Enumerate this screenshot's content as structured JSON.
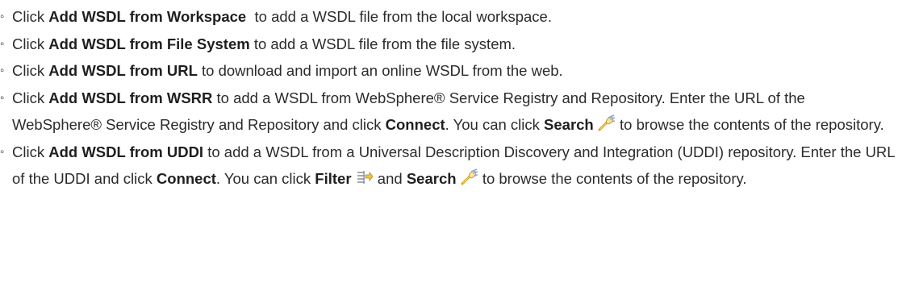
{
  "bullet_marker": "◦",
  "items": [
    {
      "pre": "Click ",
      "action": "Add WSDL from Workspace",
      "post": "  to add a WSDL file from the local workspace."
    },
    {
      "pre": "Click ",
      "action": "Add WSDL from File System",
      "post": " to add a WSDL file from the file system."
    },
    {
      "pre": "Click ",
      "action": "Add WSDL from URL",
      "post": " to download and import an online WSDL from the web."
    },
    {
      "pre": "Click ",
      "action": "Add WSDL from WSRR",
      "post1": " to add a WSDL from WebSphere® Service Registry and Repository. Enter the URL of the WebSphere® Service Registry and Repository and click ",
      "connect": "Connect",
      "mid": ". You can click ",
      "search": "Search",
      "post2": " to browse the contents of the repository.",
      "search_icon": "search-icon"
    },
    {
      "pre": "Click ",
      "action": "Add WSDL from UDDI",
      "post1": " to add a WSDL from a Universal Description Discovery and Integration (UDDI) repository. Enter the URL of the UDDI and click ",
      "connect": "Connect",
      "mid": ". You can click ",
      "filter": "Filter",
      "and": " and ",
      "search": "Search",
      "post2": " to browse the contents of the repository.",
      "filter_icon": "filter-icon",
      "search_icon": "search-icon"
    }
  ]
}
